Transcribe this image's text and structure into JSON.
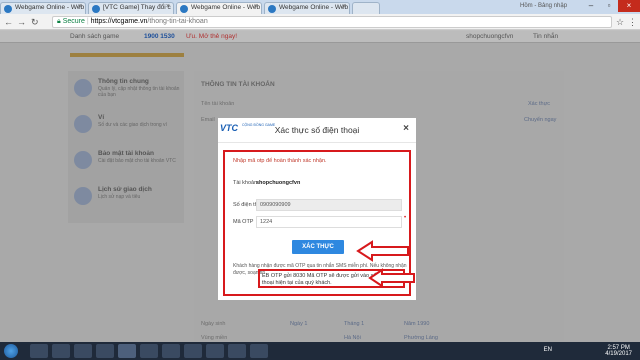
{
  "browser": {
    "tabs": [
      {
        "label": "Webgame Online - Web",
        "active": false
      },
      {
        "label": "[VTC Game] Thay đổi c",
        "active": false
      },
      {
        "label": "Webgame Online - Web",
        "active": true
      },
      {
        "label": "Webgame Online - Web",
        "active": false
      }
    ],
    "tab_right": "Hồm - Bảng nhập",
    "url": {
      "secure": "Secure",
      "host": "https://vtcgame.vn",
      "path": "/thong-tin-tai-khoan"
    }
  },
  "site_header": {
    "games": "Danh sách game",
    "phone": "1900 1530",
    "promo": "Ưu. Mở thẻ ngay!",
    "user": "shopchuongcfvn",
    "messages": "Tin nhắn"
  },
  "sidebar": {
    "items": [
      {
        "title": "Thông tin chung",
        "sub": "Quản lý, cập nhật thông tin tài khoản của bạn"
      },
      {
        "title": "Ví",
        "sub": "Số dư và các giao dịch trong ví"
      },
      {
        "title": "Bảo mật tài khoản",
        "sub": "Cài đặt bảo mật cho tài khoản VTC"
      },
      {
        "title": "Lịch sử giao dịch",
        "sub": "Lịch sử nạp và tiêu"
      }
    ]
  },
  "content": {
    "section_title": "THÔNG TIN TÀI KHOẢN",
    "rows": [
      "Tên tài khoản",
      "Email",
      "Số điện thoại",
      "Ngày sinh",
      "CMND"
    ],
    "links": [
      "Xác thực",
      "Chuyển ngay"
    ],
    "bottom": {
      "row1": "Ngày sinh",
      "row2": "Vùng miền",
      "selects": [
        "Ngày 1",
        "Tháng 1",
        "Năm 1990",
        "Hà Nội",
        "Phường Láng"
      ]
    }
  },
  "modal": {
    "logo": "VTC",
    "logo_sub": "CỘNG ĐỒNG GAME",
    "title": "Xác thực số điện thoại",
    "note": "Nhập mã otp để hoàn thành xác nhận.",
    "account_label": "Tài khoản:",
    "account_value": "shopchuongcfvn",
    "phone_label": "Số điện thoại",
    "phone_value": "0909090909",
    "otp_label": "Mã OTP",
    "otp_value": "1224",
    "confirm_button": "XÁC THỰC",
    "info_text": "Khách hàng nhận được mã OTP qua tin nhắn SMS miễn phí. Nếu không nhận được, soạn tin",
    "info_highlight": "EB OTP gửi 8030 Mã OTP sẽ được gửi vào số điện thoại hiện tại của quý khách."
  },
  "taskbar": {
    "lang": "EN",
    "time": "2:57 PM",
    "date": "4/19/2017"
  },
  "colors": {
    "accent_red": "#d7191c",
    "button_blue": "#2e88e0",
    "vtc_blue": "#1a5fb4"
  }
}
